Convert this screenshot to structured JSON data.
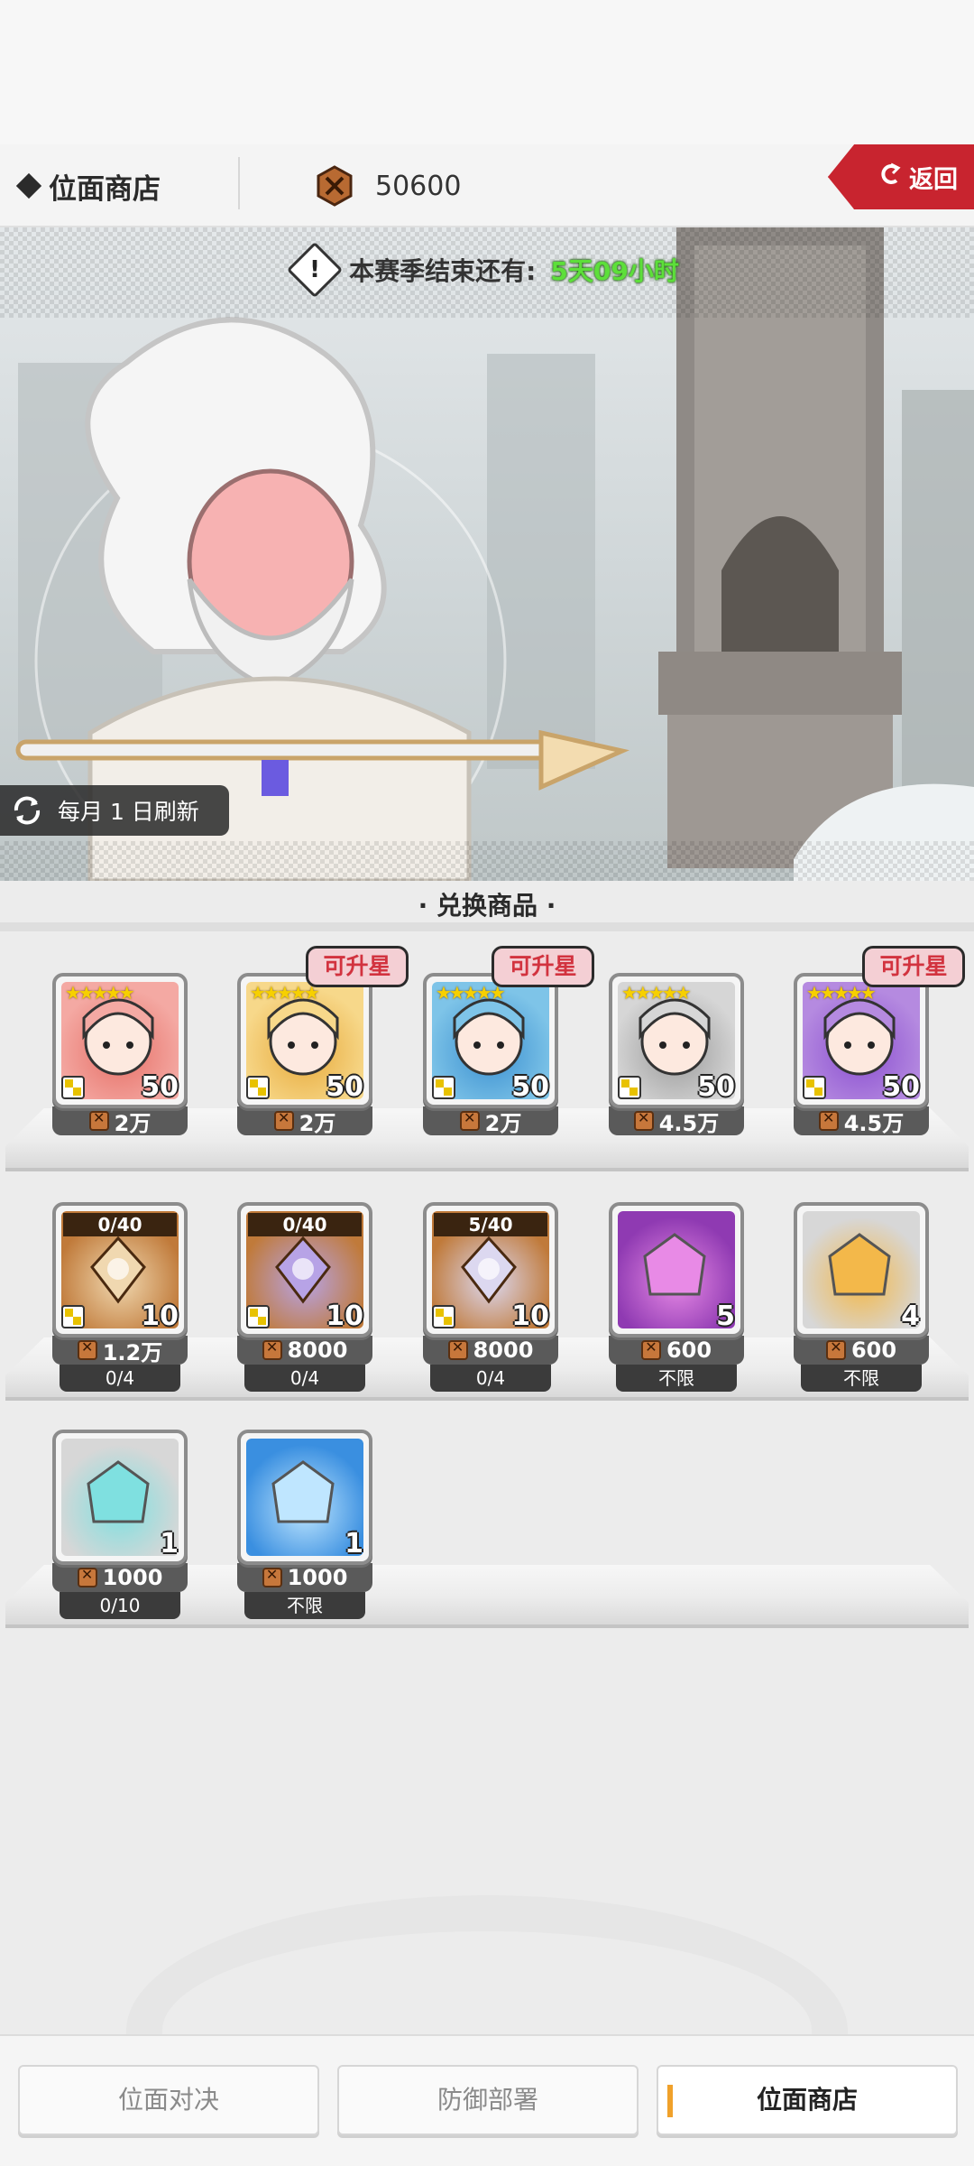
{
  "header": {
    "title": "位面商店",
    "currency_amount": "50600",
    "back_label": "返回"
  },
  "banner": {
    "season_label": "本赛季结束还有:",
    "season_time": "5天09小时",
    "refresh_label": "每月 1 日刷新"
  },
  "section_title": "· 兑换商品 ·",
  "rows": [
    {
      "items": [
        {
          "kind": "hero",
          "stars": "★★★★★",
          "qty": "50",
          "price": "2万",
          "badge": "",
          "color": "#f4a9a3",
          "accent": "#e66f66"
        },
        {
          "kind": "hero",
          "stars": "★★★★★",
          "qty": "50",
          "price": "2万",
          "badge": "可升星",
          "color": "#f7d88a",
          "accent": "#e7a93a"
        },
        {
          "kind": "hero",
          "stars": "★★★★★",
          "qty": "50",
          "price": "2万",
          "badge": "可升星",
          "color": "#7ec4e8",
          "accent": "#3a8fd0"
        },
        {
          "kind": "hero",
          "stars": "★★★★★",
          "qty": "50",
          "price": "4.5万",
          "badge": "",
          "color": "#d6d6d6",
          "accent": "#9a9a9a"
        },
        {
          "kind": "hero",
          "stars": "★★★★★",
          "qty": "50",
          "price": "4.5万",
          "badge": "可升星",
          "color": "#b58ae0",
          "accent": "#8a4fd0"
        }
      ]
    },
    {
      "items": [
        {
          "kind": "equip",
          "progress": "0/40",
          "qty": "10",
          "price": "1.2万",
          "limit": "0/4",
          "color": "#c07a3a",
          "accent": "#f0d8b0"
        },
        {
          "kind": "equip",
          "progress": "0/40",
          "qty": "10",
          "price": "8000",
          "limit": "0/4",
          "color": "#c07a3a",
          "accent": "#b7a3e6"
        },
        {
          "kind": "equip",
          "progress": "5/40",
          "qty": "10",
          "price": "8000",
          "limit": "0/4",
          "color": "#c07a3a",
          "accent": "#dcd8f0"
        },
        {
          "kind": "plain",
          "qty": "5",
          "price": "600",
          "limit": "不限",
          "color": "#8f3ab2",
          "accent": "#e88ae6"
        },
        {
          "kind": "plain",
          "qty": "4",
          "price": "600",
          "limit": "不限",
          "color": "#d7d7d7",
          "accent": "#f3b84a"
        }
      ]
    },
    {
      "items": [
        {
          "kind": "plain",
          "qty": "1",
          "price": "1000",
          "limit": "0/10",
          "color": "#d7d7d7",
          "accent": "#7fe0e0"
        },
        {
          "kind": "plain",
          "qty": "1",
          "price": "1000",
          "limit": "不限",
          "color": "#3a8fe0",
          "accent": "#bfe6ff"
        }
      ]
    }
  ],
  "bottom_nav": [
    {
      "label": "位面对决"
    },
    {
      "label": "防御部署"
    },
    {
      "label": "位面商店"
    }
  ]
}
